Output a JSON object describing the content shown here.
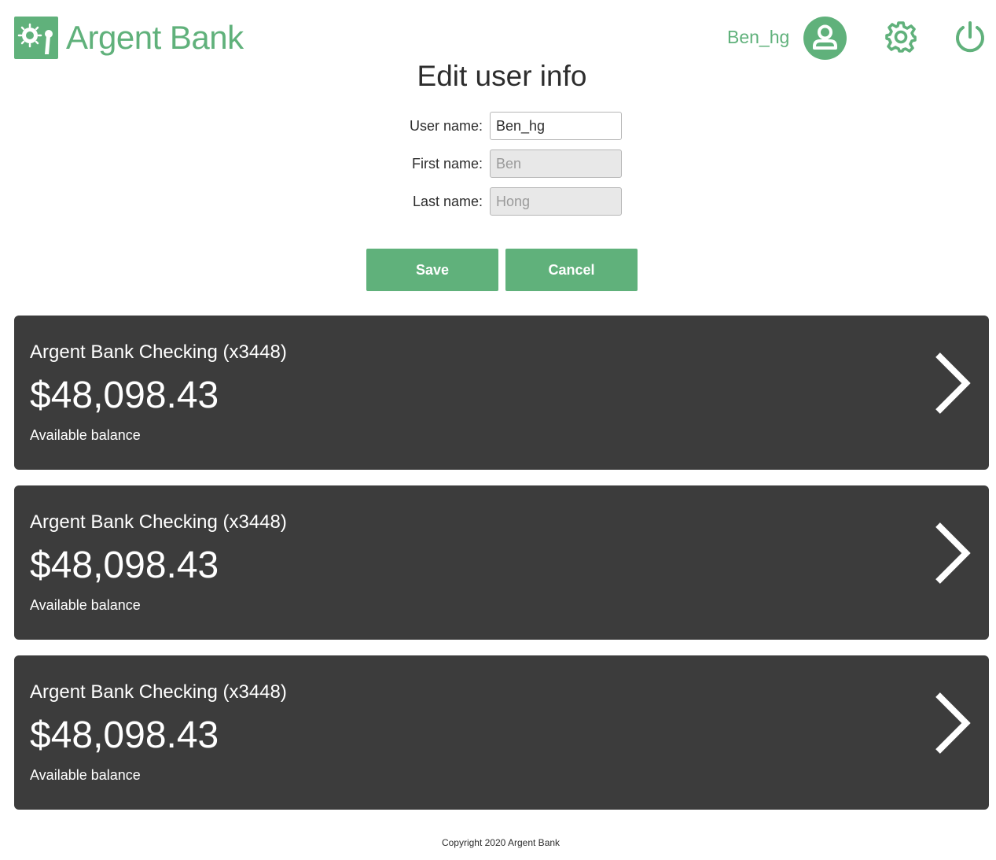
{
  "header": {
    "brand": {
      "name_part1": "Argent",
      "name_part2": "Bank",
      "logo_icon": "bank-vault-icon"
    },
    "username": "Ben_hg",
    "avatar_icon": "user-icon",
    "settings_icon": "gear-icon",
    "logout_icon": "power-icon"
  },
  "edit": {
    "title": "Edit user info",
    "fields": [
      {
        "label": "User name:",
        "value": "Ben_hg",
        "editable": true
      },
      {
        "label": "First name:",
        "value": "Ben",
        "editable": false
      },
      {
        "label": "Last name:",
        "value": "Hong",
        "editable": false
      }
    ],
    "save_label": "Save",
    "cancel_label": "Cancel"
  },
  "accounts": [
    {
      "title": "Argent Bank Checking (x3448)",
      "amount": "$48,098.43",
      "description": "Available balance"
    },
    {
      "title": "Argent Bank Checking (x3448)",
      "amount": "$48,098.43",
      "description": "Available balance"
    },
    {
      "title": "Argent Bank Checking (x3448)",
      "amount": "$48,098.43",
      "description": "Available balance"
    }
  ],
  "footer": {
    "copyright": "Copyright 2020 Argent Bank"
  },
  "colors": {
    "brand_green": "#60b17b",
    "card_bg": "#3c3c3c",
    "disabled_input": "#e8e8e8"
  }
}
